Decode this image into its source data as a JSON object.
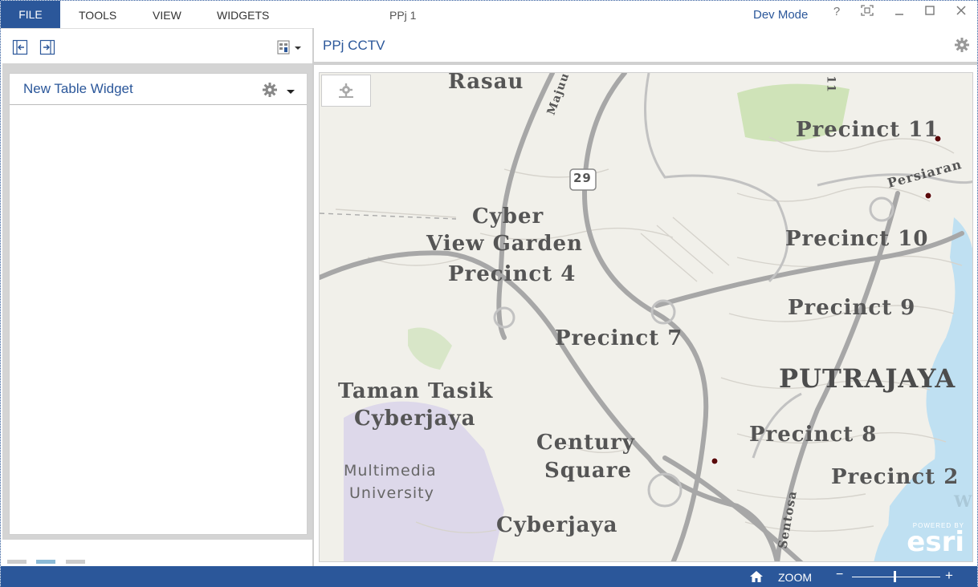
{
  "menubar": {
    "file": "FILE",
    "tools": "TOOLS",
    "view": "VIEW",
    "widgets": "WIDGETS",
    "document_title": "PPj 1",
    "dev_mode": "Dev Mode",
    "help": "?"
  },
  "left_pane": {
    "widget_title": "New Table Widget",
    "pager_active_index": 1,
    "pager_count": 3
  },
  "right_pane": {
    "title": "PPj CCTV"
  },
  "map": {
    "labels": [
      "Rasau",
      "Majuu",
      "Cyber",
      "View Garden",
      "Precinct 4",
      "Precinct 7",
      "Taman Tasik",
      "Cyberjaya",
      "Multimedia",
      "University",
      "Century",
      "Square",
      "Cyberjaya",
      "Precinct 11",
      "Persiaran",
      "Precinct 10",
      "Precinct 9",
      "PUTRAJAYA",
      "Precinct 8",
      "Precinct 2",
      "Sentosa",
      "29",
      "11",
      "W"
    ],
    "attribution_small": "POWERED BY",
    "attribution_logo": "esri"
  },
  "statusbar": {
    "zoom_label": "ZOOM",
    "zoom_minus": "−",
    "zoom_plus": "+",
    "zoom_level_fraction": 0.48
  },
  "colors": {
    "accent": "#2b579a",
    "map_background": "#f1f0ea",
    "water": "#bfe0f2",
    "park": "#cfe3b8",
    "campus": "#ddd8ea",
    "camera_marker": "#5a0a0a"
  }
}
